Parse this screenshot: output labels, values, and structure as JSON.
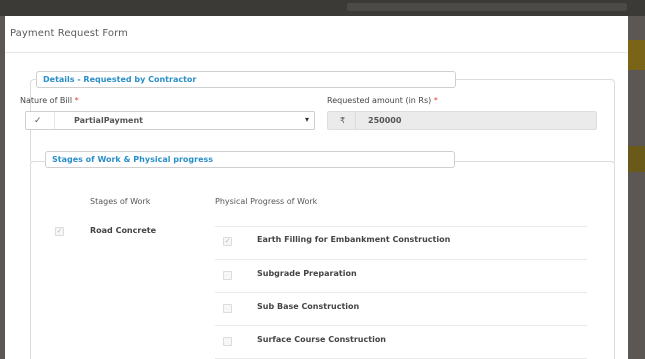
{
  "modal": {
    "title": "Payment Request Form"
  },
  "details": {
    "legend": "Details - Requested by Contractor",
    "nature_label": "Nature of Bill",
    "nature_required": "*",
    "nature_value": "PartialPayment",
    "amount_label": "Requested amount (in Rs)",
    "amount_required": "*",
    "amount_currency": "₹",
    "amount_value": "250000"
  },
  "stages": {
    "legend": "Stages of Work & Physical progress",
    "col_stage": "Stages of Work",
    "col_physical": "Physical Progress of Work",
    "stage_name": "Road Concrete",
    "progress_items": [
      {
        "label": "Earth Filling for Embankment Construction",
        "checked": true
      },
      {
        "label": "Subgrade Preparation",
        "checked": false
      },
      {
        "label": "Sub Base Construction",
        "checked": false
      },
      {
        "label": "Surface Course Construction",
        "checked": false
      }
    ]
  },
  "colors": {
    "accent": "#2a8fc9",
    "required": "#e53935",
    "backdrop": "#55524e"
  }
}
